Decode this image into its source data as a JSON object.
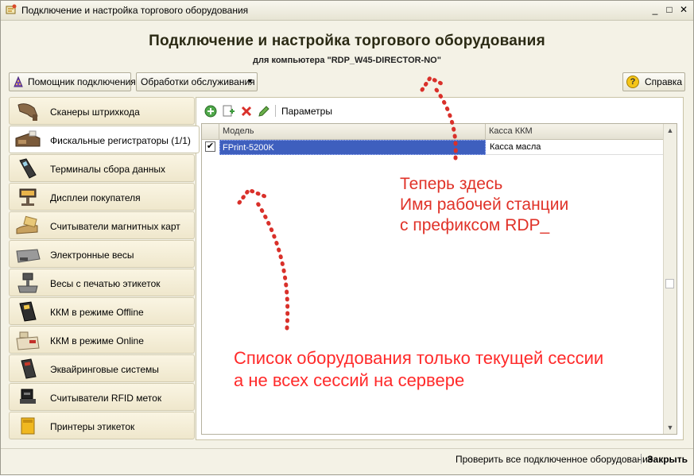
{
  "window": {
    "title": "Подключение и настройка торгового оборудования",
    "minimize": "_",
    "maximize": "□",
    "close": "✕"
  },
  "header": {
    "title": "Подключение и настройка торгового оборудования",
    "subtitle": "для компьютера \"RDP_W45-DIRECTOR-NO\""
  },
  "toolbar": {
    "assistant_label": "Помощник подключения",
    "processing_label": "Обработки обслуживания",
    "dropdown_arrow": "▾",
    "help_label": "Справка",
    "help_glyph": "?"
  },
  "categories": [
    {
      "label": "Сканеры штрихкода",
      "icon": "barcode-scanner-icon"
    },
    {
      "label": "Фискальные регистраторы (1/1)",
      "icon": "fiscal-register-icon"
    },
    {
      "label": "Терминалы сбора данных",
      "icon": "data-terminal-icon"
    },
    {
      "label": "Дисплеи покупателя",
      "icon": "customer-display-icon"
    },
    {
      "label": "Считыватели магнитных карт",
      "icon": "magnetic-card-reader-icon"
    },
    {
      "label": "Электронные весы",
      "icon": "electronic-scale-icon"
    },
    {
      "label": "Весы с печатью этикеток",
      "icon": "label-scale-icon"
    },
    {
      "label": "ККМ в режиме Offline",
      "icon": "kkm-offline-icon"
    },
    {
      "label": "ККМ в режиме Online",
      "icon": "kkm-online-icon"
    },
    {
      "label": "Эквайринговые системы",
      "icon": "acquiring-terminal-icon"
    },
    {
      "label": "Считыватели RFID меток",
      "icon": "rfid-reader-icon"
    },
    {
      "label": "Принтеры этикеток",
      "icon": "label-printer-icon"
    }
  ],
  "selected_category_index": 1,
  "device_toolbar": {
    "params_label": "Параметры"
  },
  "table": {
    "columns": [
      "Модель",
      "Касса ККМ"
    ],
    "rows": [
      {
        "checked": true,
        "check_glyph": "✔",
        "model": "FPrint-5200K",
        "kkm": "Касса масла"
      }
    ]
  },
  "scrollbar": {
    "up": "▲",
    "down": "▼"
  },
  "annotations": {
    "top_line1": "Теперь здесь",
    "top_line2": "Имя рабочей станции",
    "top_line3": "с префиксом RDP_",
    "bottom_line1": "Список оборудования только текущей сессии",
    "bottom_line2": "а не всех сессий на сервере"
  },
  "status": {
    "check_all_label": "Проверить все подключенное оборудование",
    "close_label": "Закрыть"
  },
  "colors": {
    "annotation_red": "#e03228",
    "selection_blue": "#3e5fbe",
    "header_text": "#2b2a14"
  }
}
